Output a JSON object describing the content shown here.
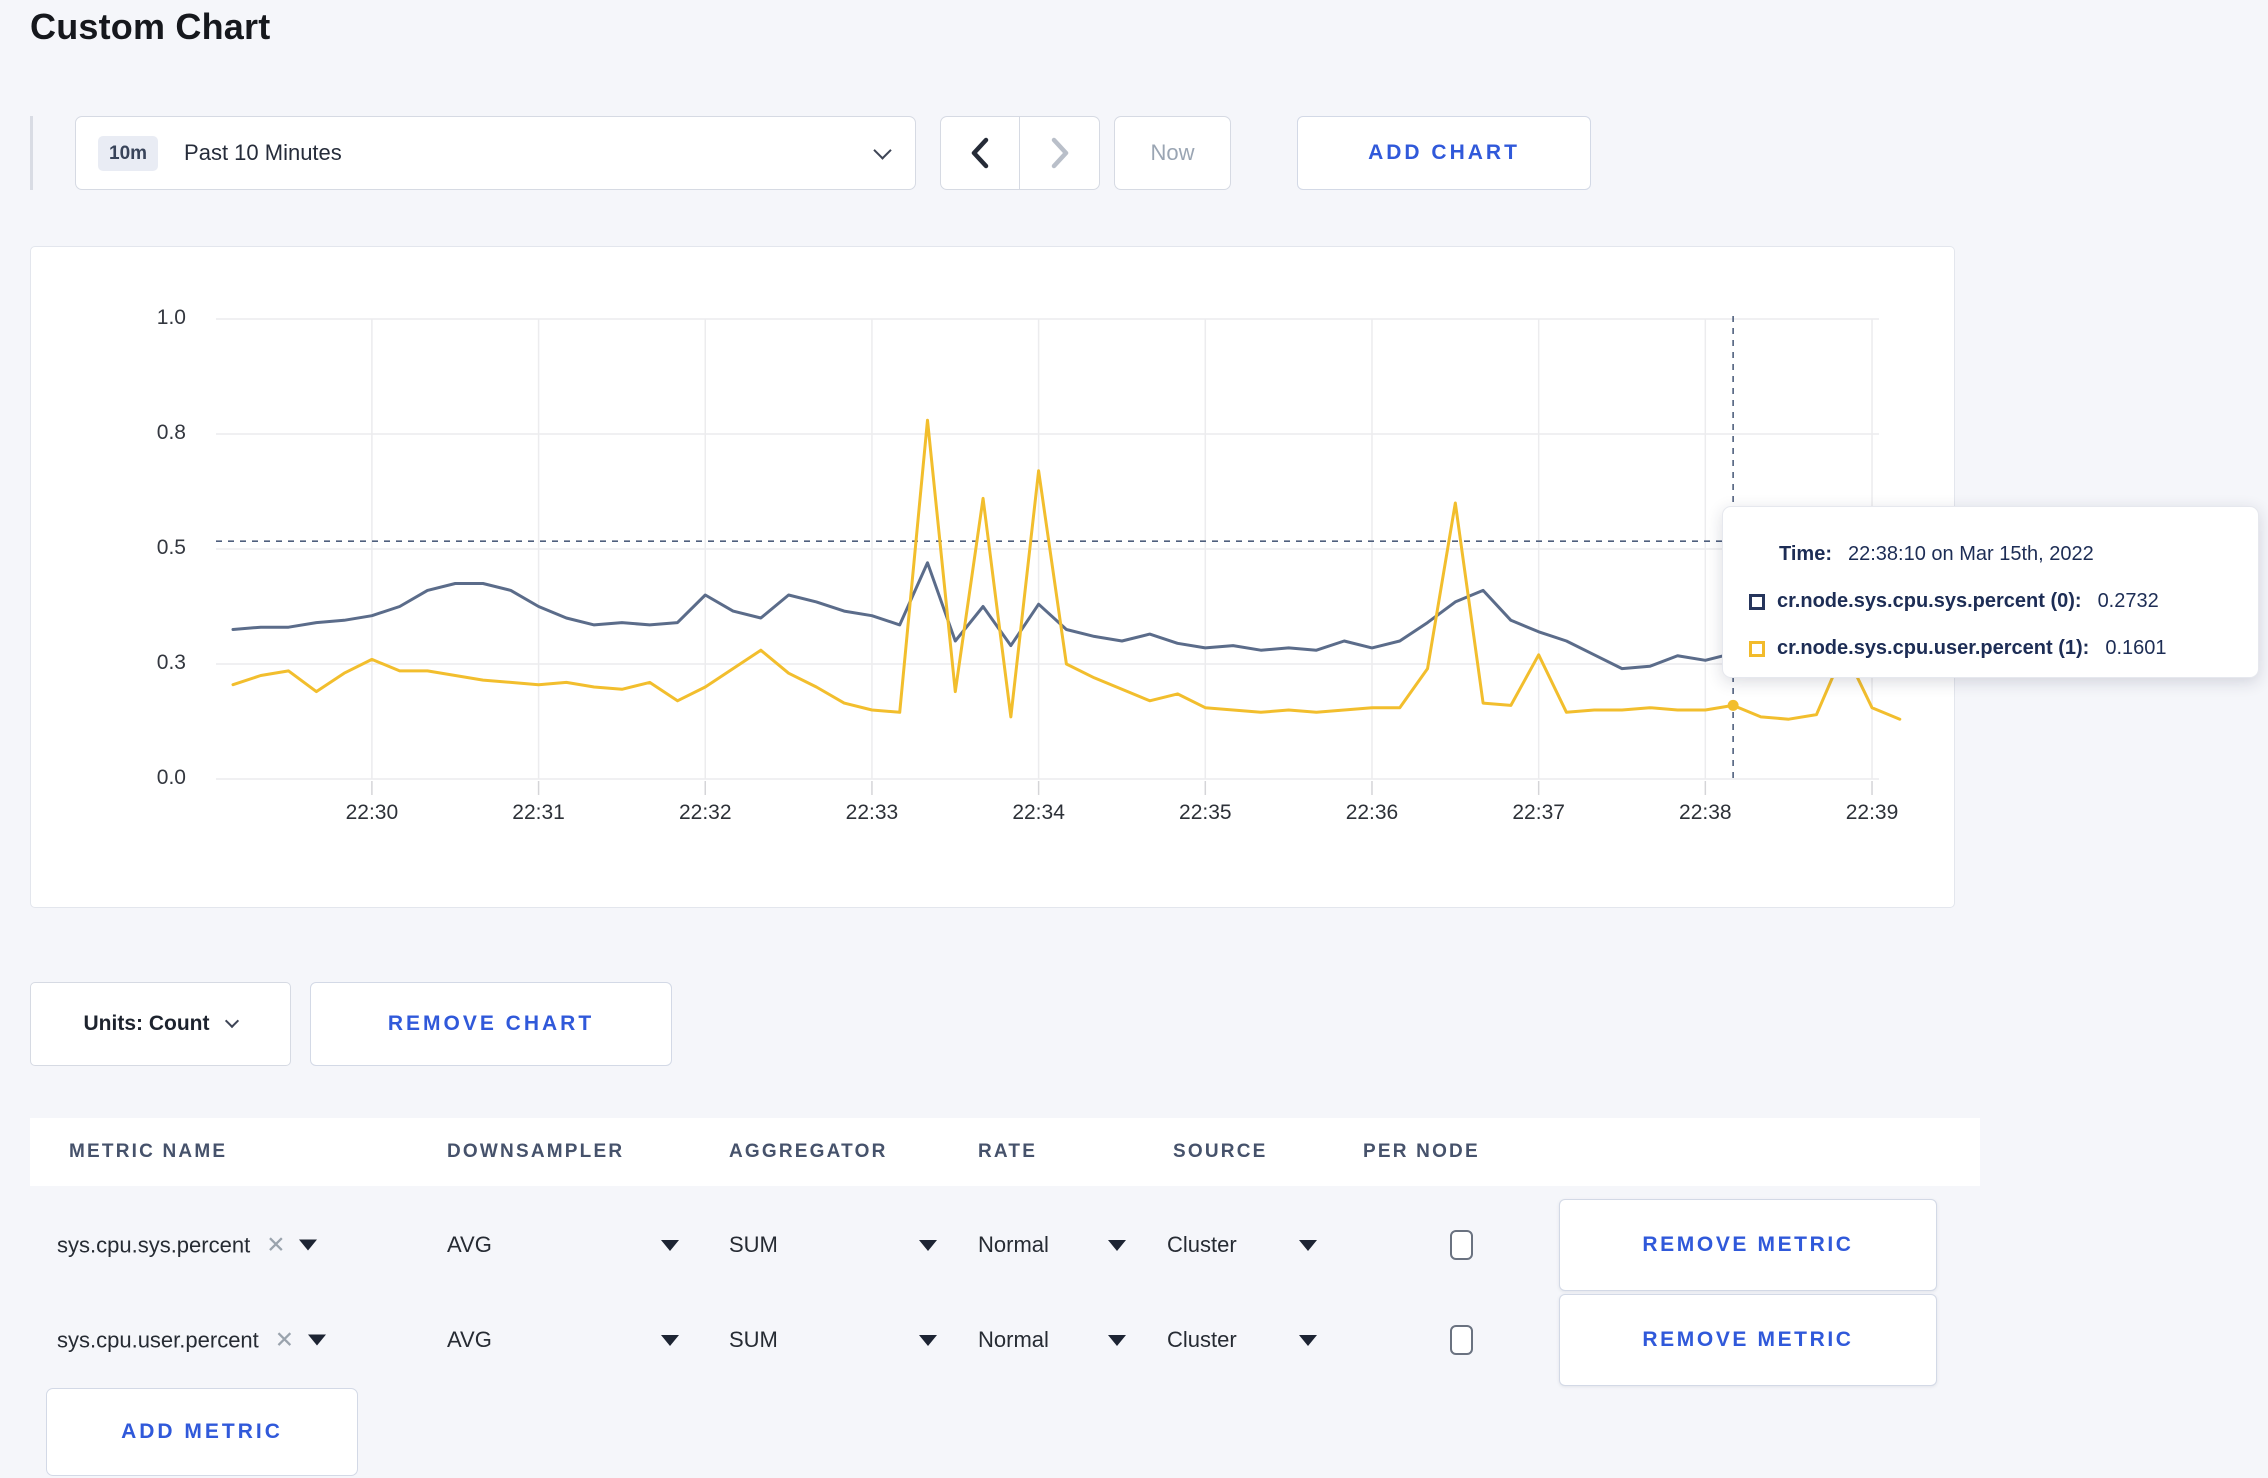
{
  "page": {
    "title": "Custom Chart",
    "background": "#f5f6fa"
  },
  "toolbar": {
    "time_range": {
      "badge": "10m",
      "label": "Past 10 Minutes"
    },
    "now_label": "Now",
    "add_chart_label": "ADD CHART"
  },
  "icons": {
    "close_glyph": "✕"
  },
  "chart_data": {
    "type": "line",
    "title": "",
    "start_time": "22:29:10",
    "interval_seconds": 10,
    "x_ticks": [
      "22:30",
      "22:31",
      "22:32",
      "22:33",
      "22:34",
      "22:35",
      "22:36",
      "22:37",
      "22:38",
      "22:39"
    ],
    "y_axis": {
      "tick_labels": [
        "0.0",
        "0.3",
        "0.5",
        "0.8",
        "1.0"
      ],
      "tick_values": [
        0,
        0.25,
        0.5,
        0.75,
        1.0
      ],
      "range": [
        0,
        1
      ]
    },
    "grid": true,
    "series": [
      {
        "name": "cr.node.sys.cpu.sys.percent",
        "color": "#5b6c8a",
        "values": [
          0.325,
          0.33,
          0.33,
          0.34,
          0.345,
          0.355,
          0.375,
          0.41,
          0.425,
          0.425,
          0.41,
          0.375,
          0.35,
          0.335,
          0.34,
          0.335,
          0.34,
          0.4,
          0.365,
          0.35,
          0.4,
          0.385,
          0.365,
          0.355,
          0.335,
          0.47,
          0.3,
          0.375,
          0.29,
          0.38,
          0.325,
          0.31,
          0.3,
          0.315,
          0.295,
          0.285,
          0.29,
          0.28,
          0.285,
          0.28,
          0.3,
          0.285,
          0.3,
          0.34,
          0.385,
          0.41,
          0.345,
          0.32,
          0.3,
          0.27,
          0.24,
          0.245,
          0.268,
          0.258,
          0.2732,
          0.295,
          0.29,
          0.3,
          0.295,
          0.305,
          0.3
        ]
      },
      {
        "name": "cr.node.sys.cpu.user.percent",
        "color": "#f2be2d",
        "values": [
          0.205,
          0.225,
          0.235,
          0.19,
          0.23,
          0.26,
          0.235,
          0.235,
          0.225,
          0.215,
          0.21,
          0.205,
          0.21,
          0.2,
          0.195,
          0.21,
          0.17,
          0.2,
          0.24,
          0.28,
          0.23,
          0.2,
          0.165,
          0.15,
          0.145,
          0.78,
          0.19,
          0.61,
          0.135,
          0.67,
          0.25,
          0.22,
          0.195,
          0.17,
          0.185,
          0.155,
          0.15,
          0.145,
          0.15,
          0.145,
          0.15,
          0.155,
          0.155,
          0.24,
          0.6,
          0.165,
          0.16,
          0.27,
          0.145,
          0.15,
          0.15,
          0.155,
          0.15,
          0.15,
          0.1601,
          0.135,
          0.13,
          0.14,
          0.28,
          0.155,
          0.13
        ]
      }
    ],
    "crosshair": {
      "index": 54,
      "time": "22:38:10",
      "hline_value": 0.517,
      "color": "#4f5f7d",
      "points": [
        {
          "series": 0,
          "value": 0.2732,
          "color": "#3d4d6b"
        },
        {
          "series": 1,
          "value": 0.1601,
          "color": "#f2be2d"
        }
      ]
    },
    "legend_position": "tooltip"
  },
  "tooltip": {
    "time_label": "Time:",
    "time_value": "22:38:10 on Mar 15th, 2022",
    "entries": [
      {
        "label": "cr.node.sys.cpu.sys.percent (0):",
        "value": "0.2732",
        "color": "#26355c"
      },
      {
        "label": "cr.node.sys.cpu.user.percent (1):",
        "value": "0.1601",
        "color": "#f2bb2b"
      }
    ]
  },
  "controls": {
    "units_label": "Units: Count",
    "remove_chart_label": "REMOVE CHART",
    "add_metric_label": "ADD METRIC"
  },
  "metrics_table": {
    "headers": [
      "METRIC NAME",
      "DOWNSAMPLER",
      "AGGREGATOR",
      "RATE",
      "SOURCE",
      "PER NODE"
    ],
    "rows": [
      {
        "metric": "sys.cpu.sys.percent",
        "downsampler": "AVG",
        "aggregator": "SUM",
        "rate": "Normal",
        "source": "Cluster",
        "per_node_checked": false,
        "remove_label": "REMOVE METRIC"
      },
      {
        "metric": "sys.cpu.user.percent",
        "downsampler": "AVG",
        "aggregator": "SUM",
        "rate": "Normal",
        "source": "Cluster",
        "per_node_checked": false,
        "remove_label": "REMOVE METRIC"
      }
    ]
  },
  "colors": {
    "accent_blue": "#3059da",
    "series_sys": "#5b6c8a",
    "series_user": "#f2be2d",
    "navy_text": "#1d2d55",
    "gridline": "#ececee",
    "page_bg": "#f5f6fa"
  }
}
